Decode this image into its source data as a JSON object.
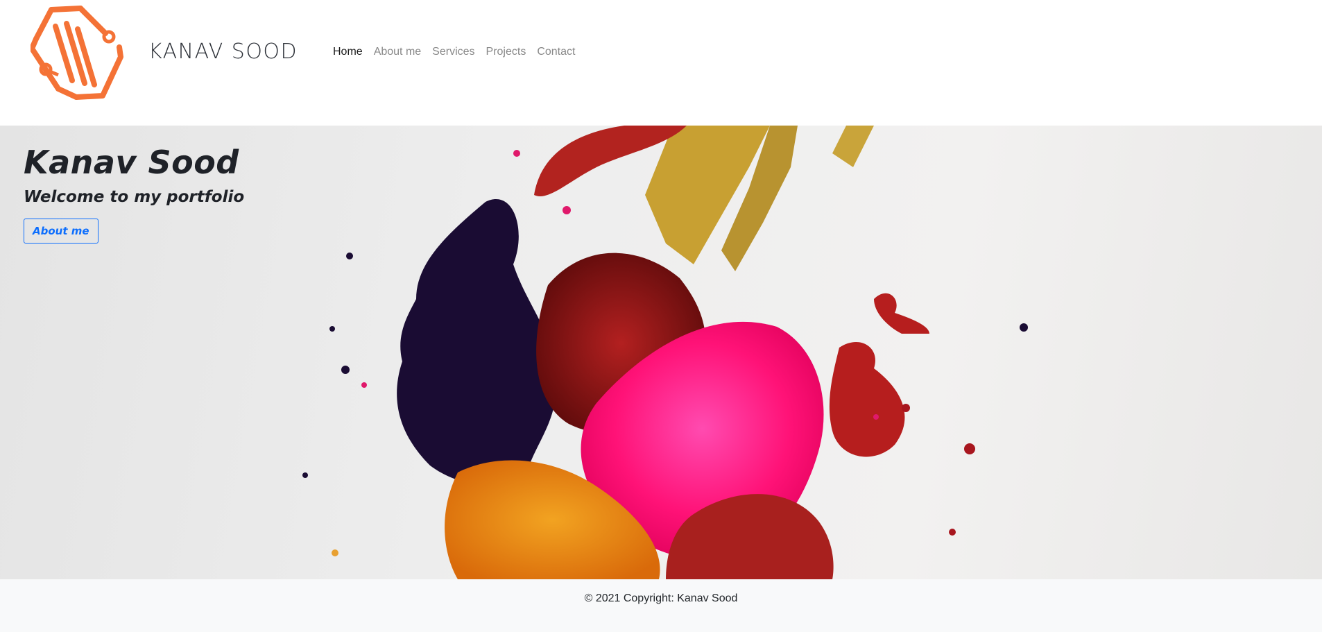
{
  "header": {
    "brand": "KANAV SOOD",
    "logo_icon": "hexagon-circuit-logo-icon",
    "accent_color": "#f47236",
    "nav": [
      {
        "label": "Home",
        "active": true
      },
      {
        "label": "About me",
        "active": false
      },
      {
        "label": "Services",
        "active": false
      },
      {
        "label": "Projects",
        "active": false
      },
      {
        "label": "Contact",
        "active": false
      }
    ]
  },
  "hero": {
    "title": "Kanav Sood",
    "subtitle": "Welcome to my portfolio",
    "button_label": "About me",
    "button_color": "#0d6efd"
  },
  "footer": {
    "copyright": "© 2021 Copyright: Kanav Sood"
  }
}
